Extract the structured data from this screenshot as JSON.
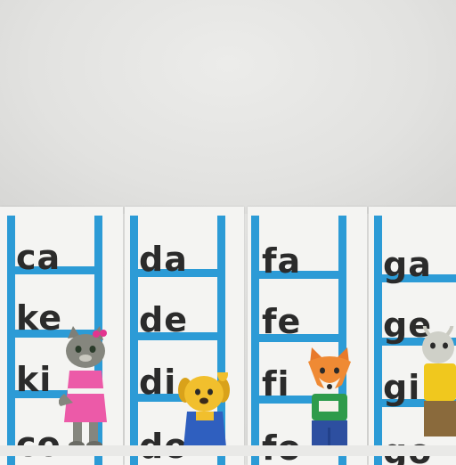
{
  "scene": "Syllable ladder cards on a wall",
  "cards": [
    {
      "syllables": [
        "ca",
        "ke",
        "ki",
        "co"
      ],
      "character": "cat-icon"
    },
    {
      "syllables": [
        "da",
        "de",
        "di",
        "do"
      ],
      "character": "dog-icon"
    },
    {
      "syllables": [
        "fa",
        "fe",
        "fi",
        "fo"
      ],
      "character": "fox-icon"
    },
    {
      "syllables": [
        "ga",
        "ge",
        "gi",
        "go"
      ],
      "character": "goat-icon"
    }
  ],
  "colors": {
    "ladder": "#2c9bd6",
    "text": "#2b2b2b",
    "card": "#f4f4f2"
  }
}
